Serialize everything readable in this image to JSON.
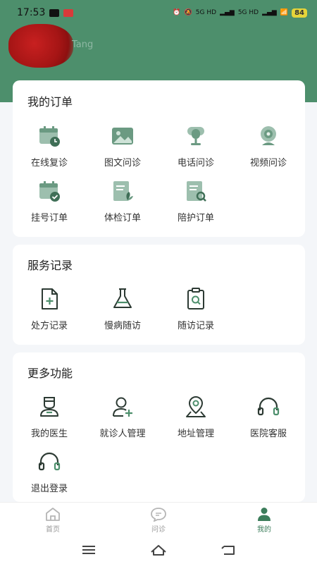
{
  "status_bar": {
    "time": "17:53",
    "battery": "84",
    "network_1": "5G HD",
    "network_2": "5G HD"
  },
  "profile": {
    "name": "Tang"
  },
  "my_orders": {
    "title": "我的订单",
    "items": [
      {
        "label": "在线复诊",
        "icon": "calendar-clock-icon"
      },
      {
        "label": "图文问诊",
        "icon": "image-icon"
      },
      {
        "label": "电话问诊",
        "icon": "microphone-icon"
      },
      {
        "label": "视频问诊",
        "icon": "webcam-icon"
      },
      {
        "label": "挂号订单",
        "icon": "calendar-check-icon"
      },
      {
        "label": "体检订单",
        "icon": "document-leaf-icon"
      },
      {
        "label": "陪护订单",
        "icon": "document-search-icon"
      }
    ]
  },
  "service_records": {
    "title": "服务记录",
    "items": [
      {
        "label": "处方记录",
        "icon": "file-plus-icon"
      },
      {
        "label": "慢病随访",
        "icon": "flask-icon"
      },
      {
        "label": "随访记录",
        "icon": "clipboard-search-icon"
      }
    ]
  },
  "more_functions": {
    "title": "更多功能",
    "items": [
      {
        "label": "我的医生",
        "icon": "doctor-icon"
      },
      {
        "label": "就诊人管理",
        "icon": "add-user-icon"
      },
      {
        "label": "地址管理",
        "icon": "location-icon"
      },
      {
        "label": "医院客服",
        "icon": "headset-icon"
      },
      {
        "label": "退出登录",
        "icon": "headset-icon"
      }
    ]
  },
  "tabbar": {
    "items": [
      {
        "label": "首页",
        "icon": "home-icon",
        "active": false
      },
      {
        "label": "问诊",
        "icon": "chat-icon",
        "active": false
      },
      {
        "label": "我的",
        "icon": "person-icon",
        "active": true
      }
    ]
  },
  "colors": {
    "brand": "#4d8f6c",
    "accent": "#3c7d5b",
    "icon_fill": "#6b9a82"
  }
}
